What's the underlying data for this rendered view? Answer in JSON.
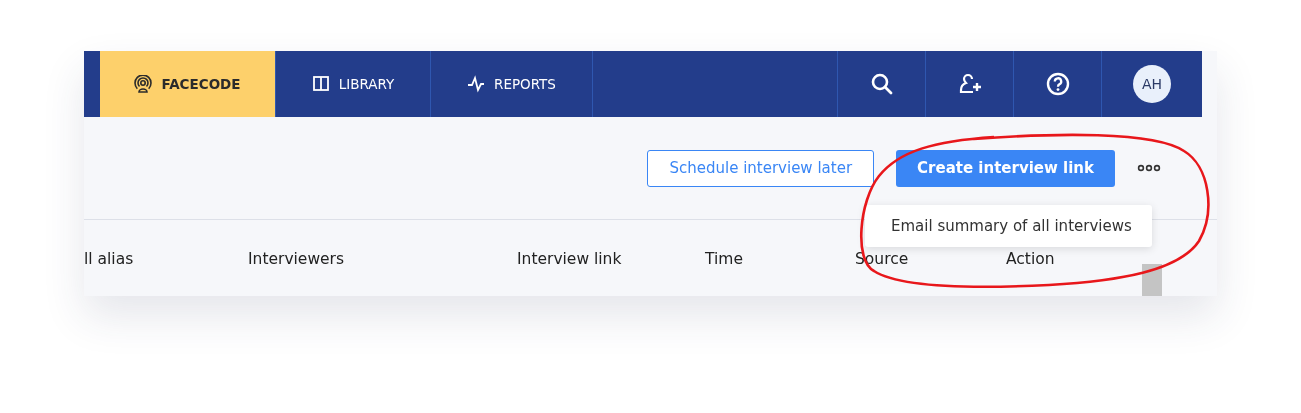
{
  "nav": {
    "tabs": [
      {
        "label": "FACECODE",
        "selected": true
      },
      {
        "label": "LIBRARY",
        "selected": false
      },
      {
        "label": "REPORTS",
        "selected": false
      }
    ],
    "avatar": "AH"
  },
  "toolbar": {
    "buttons": [
      {
        "label": "Schedule interview later",
        "kind": "outline"
      },
      {
        "label": "Create interview link",
        "kind": "primary"
      }
    ],
    "menu": {
      "items": [
        "Email summary of all interviews"
      ]
    }
  },
  "table": {
    "columns": [
      "ll alias",
      "Interviewers",
      "Interview link",
      "Time",
      "Source",
      "Action"
    ]
  }
}
